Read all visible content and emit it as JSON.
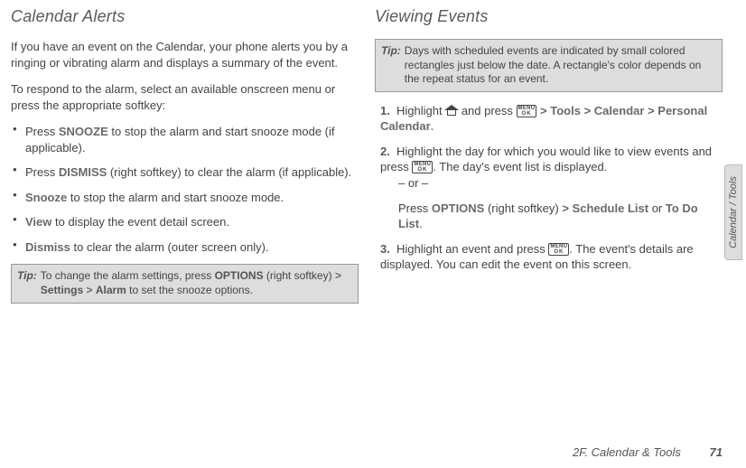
{
  "left": {
    "heading": "Calendar Alerts",
    "intro1": "If you have an event on the Calendar, your phone alerts you by a ringing or vibrating alarm and displays a summary of the event.",
    "intro2": "To respond to the alarm, select an available onscreen menu or press the appropriate softkey:",
    "items": [
      {
        "pre": "Press ",
        "bold": "SNOOZE",
        "post": " to stop the alarm and start snooze mode (if applicable)."
      },
      {
        "pre": "Press ",
        "bold": "DISMISS",
        "post": " (right softkey) to clear the alarm (if applicable)."
      },
      {
        "pre": "",
        "bold": "Snooze",
        "post": " to stop the alarm and start snooze mode."
      },
      {
        "pre": "",
        "bold": "View",
        "post": " to display the event detail screen."
      },
      {
        "pre": "",
        "bold": "Dismiss",
        "post": " to clear the alarm (outer screen only)."
      }
    ],
    "tip": {
      "label": "Tip:",
      "t1": "To change the alarm settings, press ",
      "b1": "OPTIONS",
      "t2": " (right softkey) ",
      "gt1": ">",
      "b2": "Settings",
      "gt2": ">",
      "b3": "Alarm",
      "t3": " to set the snooze options."
    }
  },
  "right": {
    "heading": "Viewing Events",
    "tip": {
      "label": "Tip:",
      "text": "Days with scheduled events are indicated by small colored rectangles just below the date. A rectangle's color depends on the repeat status for an event."
    },
    "step1": {
      "num": "1.",
      "t1": "Highlight ",
      "t2": " and press ",
      "gt1": ">",
      "b1": "Tools",
      "gt2": ">",
      "b2": "Calendar",
      "gt3": ">",
      "b3": "Personal Calendar",
      "t3": "."
    },
    "step2": {
      "num": "2.",
      "t1": "Highlight the day for which you would like to view events and press ",
      "t2": ". The day's event list is displayed."
    },
    "or": "– or –",
    "step2b": {
      "t1": "Press ",
      "b1": "OPTIONS",
      "t2": " (right softkey) ",
      "gt1": ">",
      "b2": "Schedule List",
      "t3": " or ",
      "b3": "To Do List",
      "t4": "."
    },
    "step3": {
      "num": "3.",
      "t1": "Highlight an event and press ",
      "t2": ". The event's details are displayed. You can edit the event on this screen."
    }
  },
  "ok_lines": {
    "l1": "MENU",
    "l2": "OK"
  },
  "side_tab": "Calendar / Tools",
  "footer": {
    "section": "2F. Calendar & Tools",
    "page": "71"
  }
}
